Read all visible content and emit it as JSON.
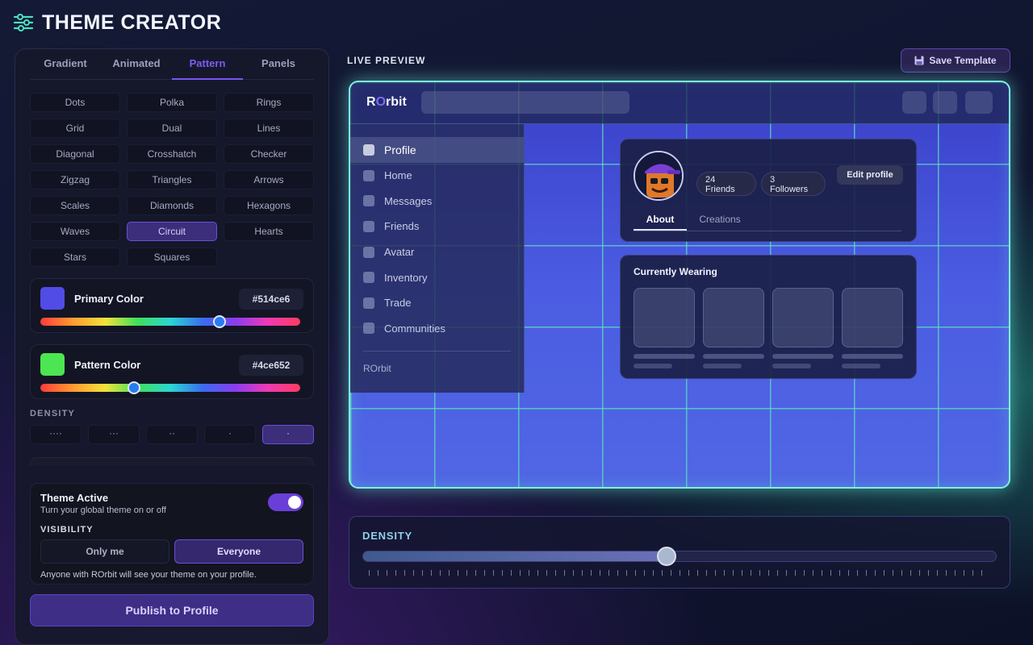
{
  "app": {
    "title": "THEME CREATOR",
    "icon": "sliders-icon"
  },
  "tabs": [
    {
      "label": "Gradient",
      "active": false
    },
    {
      "label": "Animated",
      "active": false
    },
    {
      "label": "Pattern",
      "active": true
    },
    {
      "label": "Panels",
      "active": false
    }
  ],
  "patterns": [
    {
      "label": "Dots"
    },
    {
      "label": "Polka"
    },
    {
      "label": "Rings"
    },
    {
      "label": "Grid"
    },
    {
      "label": "Dual"
    },
    {
      "label": "Lines"
    },
    {
      "label": "Diagonal"
    },
    {
      "label": "Crosshatch"
    },
    {
      "label": "Checker"
    },
    {
      "label": "Zigzag"
    },
    {
      "label": "Triangles"
    },
    {
      "label": "Arrows"
    },
    {
      "label": "Scales"
    },
    {
      "label": "Diamonds"
    },
    {
      "label": "Hexagons"
    },
    {
      "label": "Waves"
    },
    {
      "label": "Circuit",
      "selected": true
    },
    {
      "label": "Hearts"
    },
    {
      "label": "Stars"
    },
    {
      "label": "Squares"
    }
  ],
  "primary_color": {
    "label": "Primary Color",
    "hex": "#514ce6",
    "hue_position": 0.69
  },
  "pattern_color": {
    "label": "Pattern Color",
    "hex": "#4ce652",
    "hue_position": 0.36
  },
  "density": {
    "label": "DENSITY",
    "options": [
      {
        "label": "····"
      },
      {
        "label": "···"
      },
      {
        "label": "··"
      },
      {
        "label": "·"
      },
      {
        "label": "·",
        "selected": true
      }
    ]
  },
  "theme": {
    "title": "Theme Active",
    "subtitle": "Turn your global theme on or off",
    "active": true,
    "visibility_label": "VISIBILITY",
    "visibility_options": [
      {
        "label": "Only me",
        "selected": false
      },
      {
        "label": "Everyone",
        "selected": true
      }
    ],
    "note": "Anyone with ROrbit will see your theme on your profile."
  },
  "publish_label": "Publish to Profile",
  "live_preview_label": "LIVE PREVIEW",
  "save_template_label": "Save Template",
  "preview": {
    "logo_prefix": "R",
    "logo_accent": "O",
    "logo_suffix": "rbit",
    "nav": [
      {
        "label": "Profile",
        "active": true
      },
      {
        "label": "Home"
      },
      {
        "label": "Messages"
      },
      {
        "label": "Friends"
      },
      {
        "label": "Avatar"
      },
      {
        "label": "Inventory"
      },
      {
        "label": "Trade"
      },
      {
        "label": "Communities"
      }
    ],
    "sidebar_footer": "ROrbit",
    "friends_count": "24",
    "friends_label": "Friends",
    "followers_count": "3",
    "followers_label": "Followers",
    "edit_profile_label": "Edit profile",
    "profile_tabs": [
      {
        "label": "About",
        "active": true
      },
      {
        "label": "Creations",
        "active": false
      }
    ],
    "wearing_title": "Currently Wearing"
  },
  "density_slider": {
    "label": "DENSITY",
    "value": 0.48
  },
  "colors": {
    "accent": "#7b55f0",
    "primary": "#514ce6",
    "pattern": "#4ce652"
  }
}
